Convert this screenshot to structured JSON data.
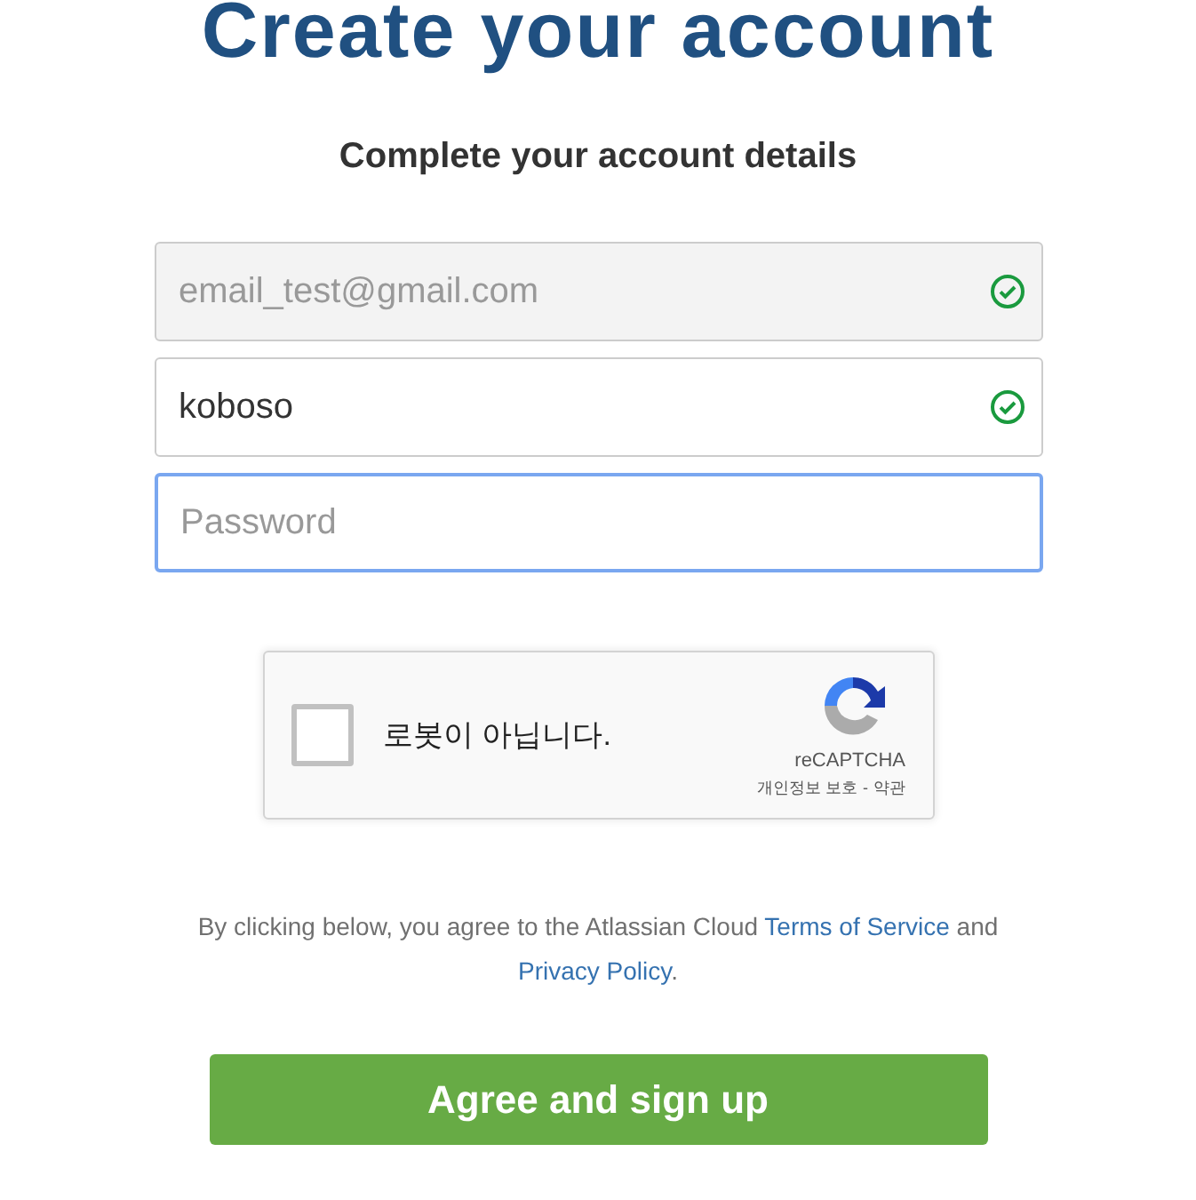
{
  "title": "Create your account",
  "subtitle": "Complete your account details",
  "fields": [
    {
      "value": "email_test@gmail.com",
      "disabled": true,
      "valid": true,
      "focused": false
    },
    {
      "value": "koboso",
      "disabled": false,
      "valid": true,
      "focused": false
    },
    {
      "placeholder": "Password",
      "disabled": false,
      "valid": false,
      "focused": true
    }
  ],
  "captcha": {
    "label": "로봇이 아닙니다.",
    "checked": false,
    "brand": "reCAPTCHA",
    "links": [
      "개인정보 보호",
      "-",
      "약관"
    ]
  },
  "terms": [
    {
      "kind": "text",
      "text": "By clicking below, you agree to the Atlassian Cloud "
    },
    {
      "kind": "link",
      "text": "Terms of Service"
    },
    {
      "kind": "text",
      "text": " and "
    },
    {
      "kind": "link",
      "text": "Privacy Policy"
    },
    {
      "kind": "text",
      "text": "."
    }
  ],
  "submit": "Agree and sign up"
}
